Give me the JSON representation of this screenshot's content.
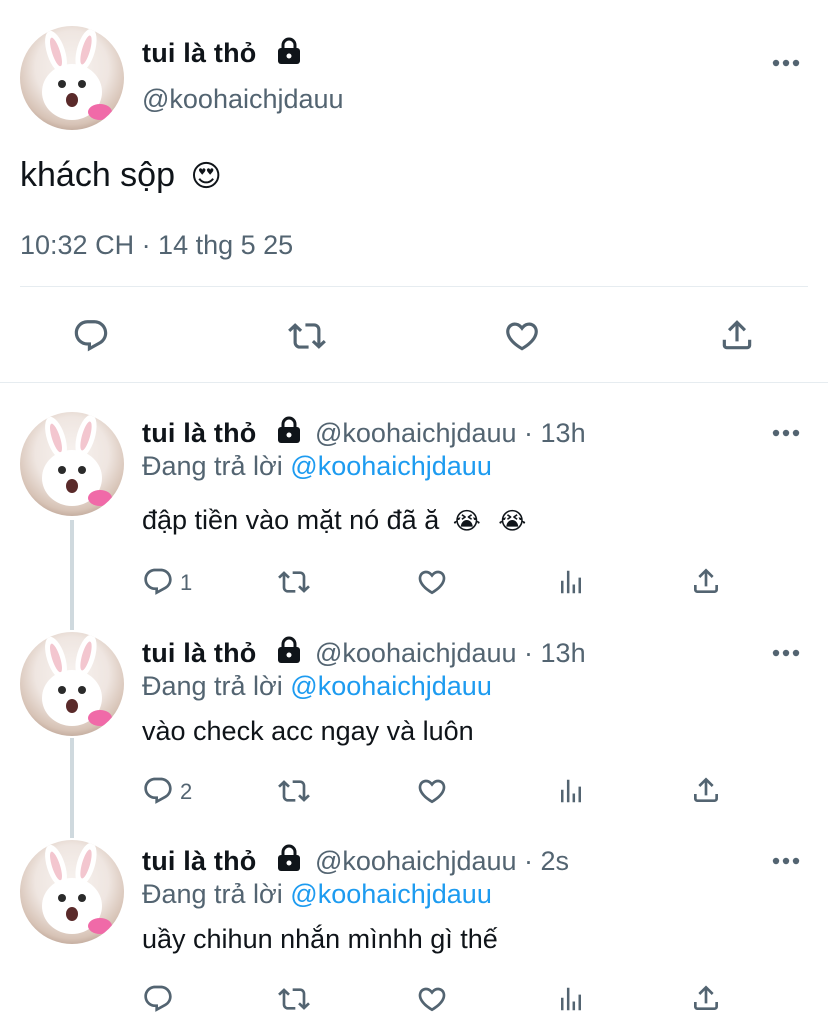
{
  "main_tweet": {
    "display_name": "tui là thỏ",
    "handle": "@koohaichjdauu",
    "text": "khách sộp",
    "emoji": "😍",
    "timestamp": "10:32 CH · 14 thg 5 25",
    "protected_icon": "lock-icon"
  },
  "replies": [
    {
      "display_name": "tui là thỏ",
      "handle": "@koohaichjdauu · 13h",
      "replying_to_label": "Đang trả lời",
      "replying_to_handle": "@koohaichjdauu",
      "text": "đập tiền vào mặt nó đã ă",
      "emoji1": "😭",
      "emoji2": "😭",
      "reply_count": "1"
    },
    {
      "display_name": "tui là thỏ",
      "handle": "@koohaichjdauu · 13h",
      "replying_to_label": "Đang trả lời",
      "replying_to_handle": "@koohaichjdauu",
      "text": "vào check acc ngay và luôn",
      "reply_count": "2"
    },
    {
      "display_name": "tui là thỏ",
      "handle": "@koohaichjdauu · 2s",
      "replying_to_label": "Đang trả lời",
      "replying_to_handle": "@koohaichjdauu",
      "text": "uầy chihun nhắn mìnhh gì thế",
      "reply_count": ""
    }
  ],
  "colors": {
    "text": "#0f1419",
    "secondary": "#536471",
    "link": "#1d9bf0",
    "divider": "#e6ecf0"
  },
  "icons": [
    "lock-icon",
    "more-icon",
    "reply-icon",
    "retweet-icon",
    "like-icon",
    "share-icon",
    "analytics-icon"
  ]
}
